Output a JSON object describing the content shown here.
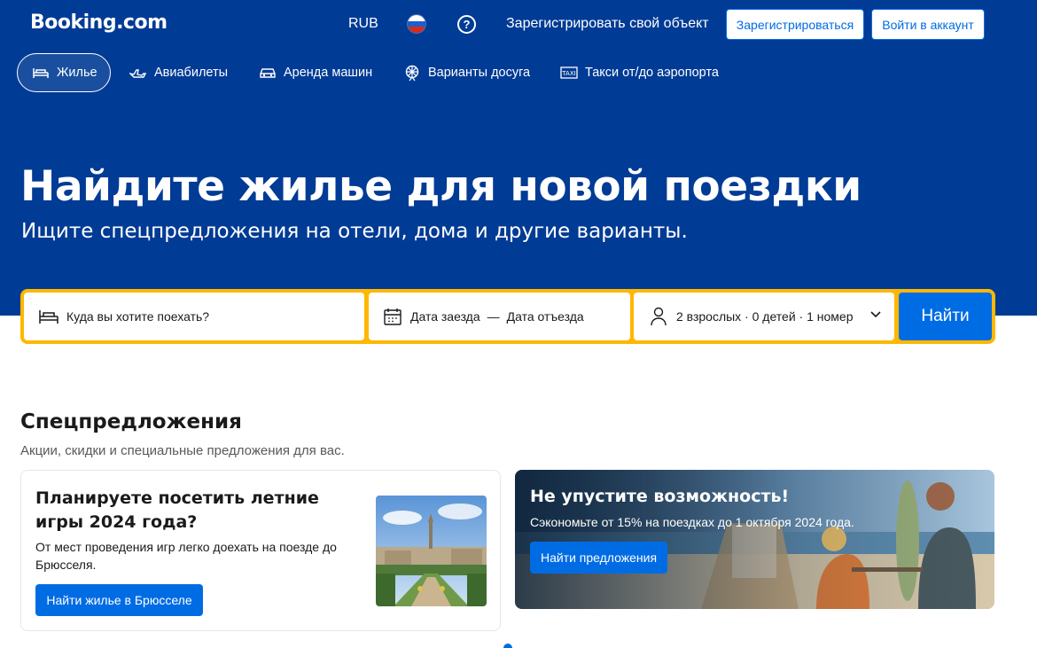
{
  "header": {
    "logo": "Booking.com",
    "currency": "RUB",
    "flag_icon": "russia-flag-icon",
    "help": "?",
    "list_property": "Зарегистрировать свой объект",
    "register": "Зарегистрироваться",
    "login": "Войти в аккаунт"
  },
  "nav": {
    "tabs": [
      {
        "label": "Жилье",
        "icon": "bed-icon",
        "active": true
      },
      {
        "label": "Авиабилеты",
        "icon": "plane-icon",
        "active": false
      },
      {
        "label": "Аренда машин",
        "icon": "car-icon",
        "active": false
      },
      {
        "label": "Варианты досуга",
        "icon": "attractions-icon",
        "active": false
      },
      {
        "label": "Такси от/до аэропорта",
        "icon": "taxi-icon",
        "active": false
      }
    ]
  },
  "hero": {
    "title": "Найдите жилье для новой поездки",
    "subtitle": "Ищите спецпредложения на отели, дома и другие варианты."
  },
  "search": {
    "destination_placeholder": "Куда вы хотите поехать?",
    "checkin": "Дата заезда",
    "dash": "—",
    "checkout": "Дата отъезда",
    "guests": "2 взрослых · 0 детей · 1 номер",
    "button": "Найти"
  },
  "offers": {
    "title": "Спецпредложения",
    "subtitle": "Акции, скидки и специальные предложения для вас.",
    "card1": {
      "title": "Планируете посетить летние игры 2024 года?",
      "text": "От мест проведения игр легко доехать на поезде до Брюсселя.",
      "button": "Найти жилье в Брюсселе"
    },
    "card2": {
      "title": "Не упустите возможность!",
      "text": "Сэкономьте от 15% на поездках до 1 октября 2024 года.",
      "button": "Найти предложения"
    }
  },
  "colors": {
    "brand_blue": "#003b95",
    "action_blue": "#006ce4",
    "search_border": "#ffb700"
  }
}
